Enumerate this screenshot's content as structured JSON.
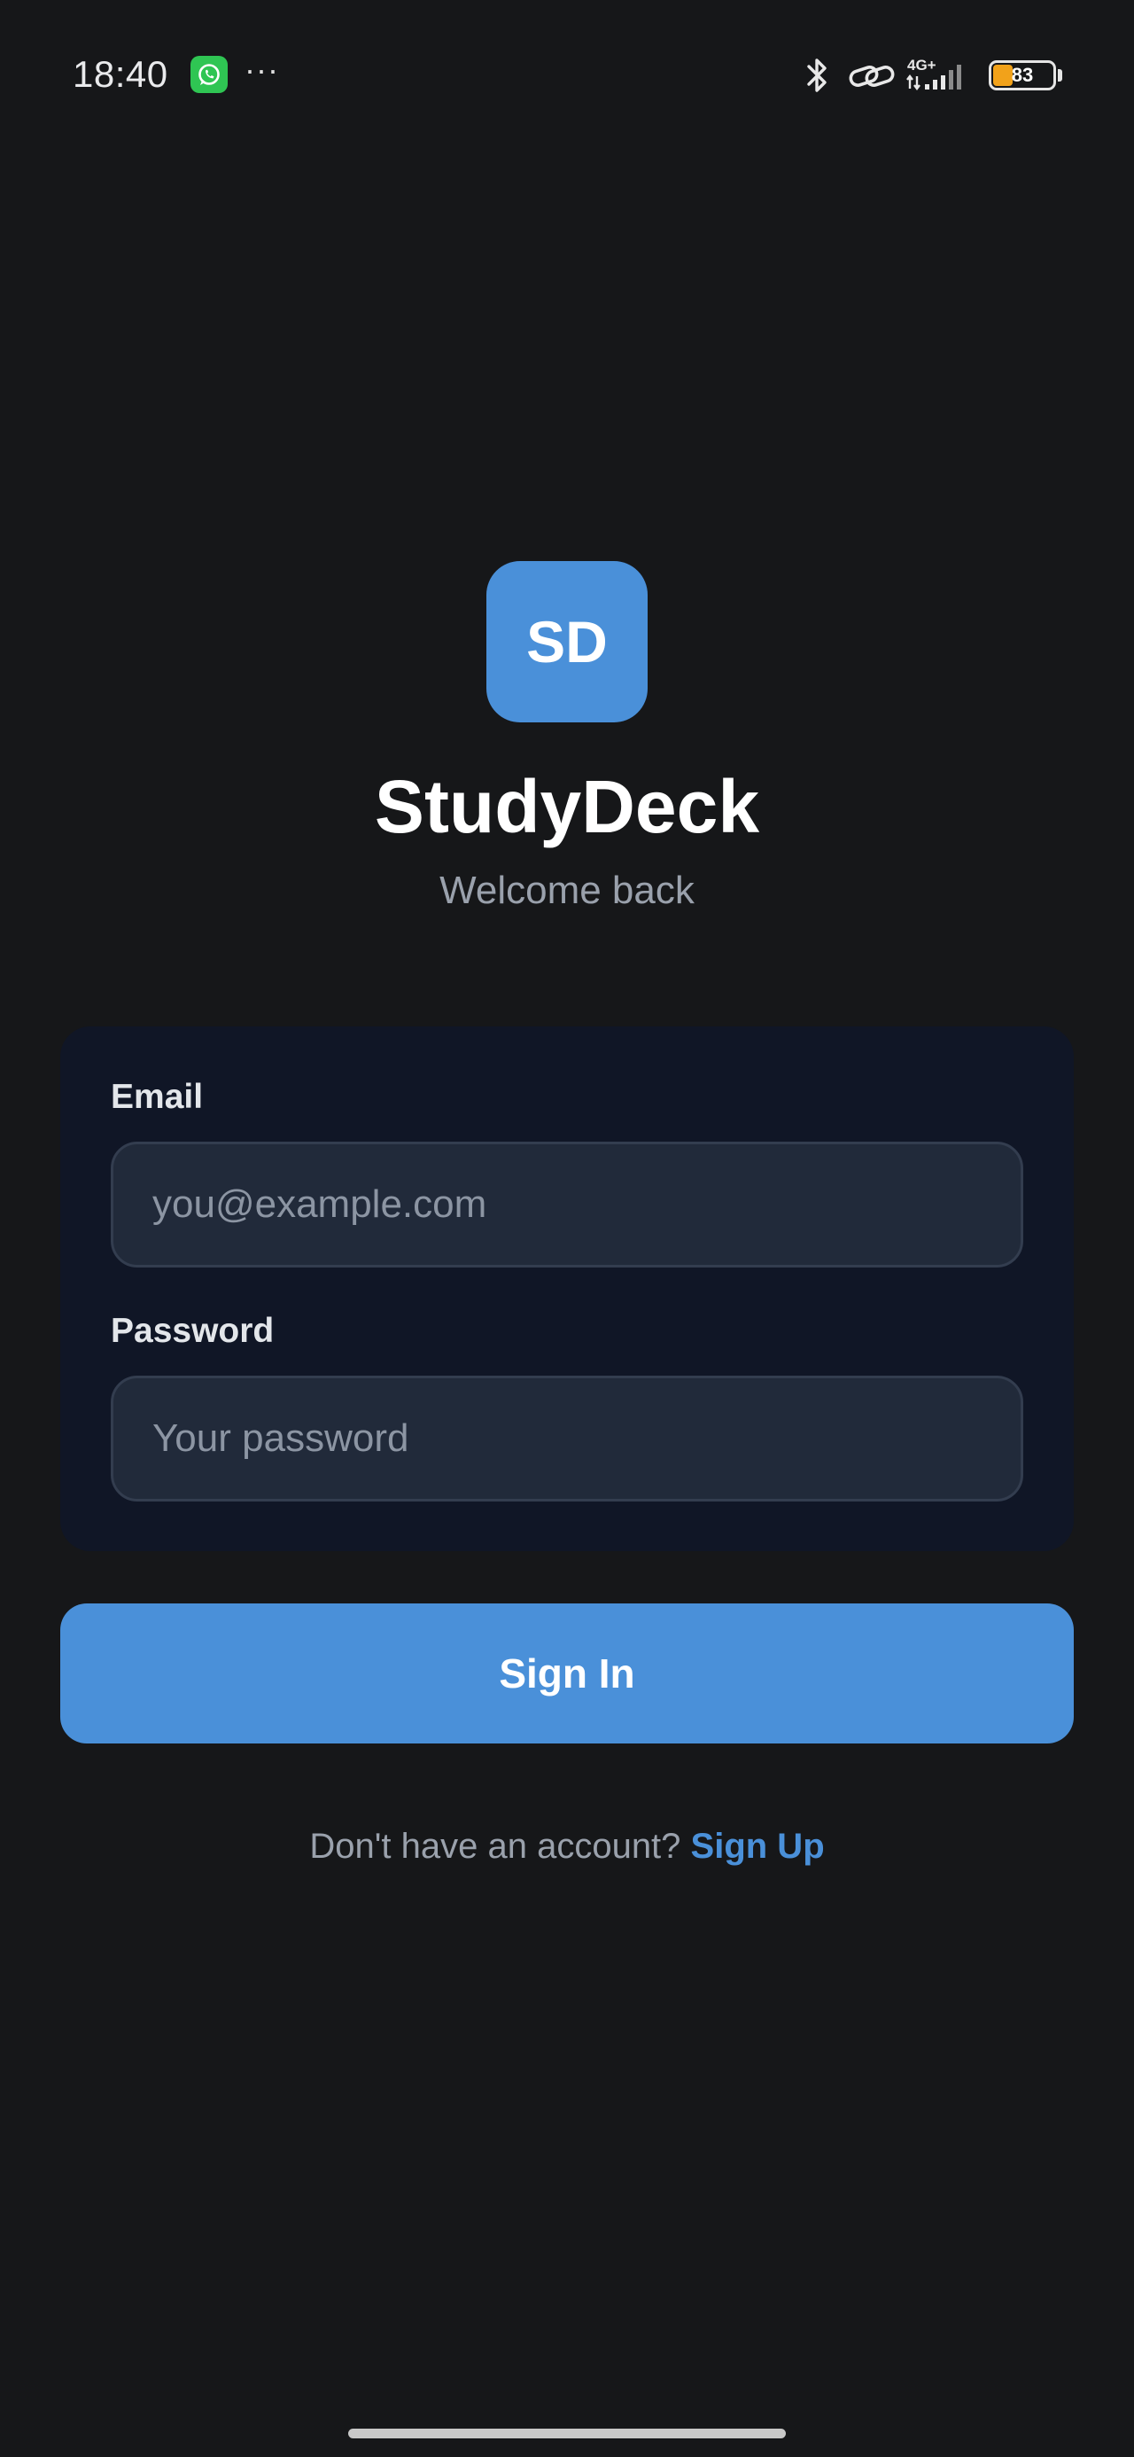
{
  "status_bar": {
    "time": "18:40",
    "more_indicator": "···",
    "network_label": "4G+",
    "battery_level": "83",
    "battery_fraction": 0.33
  },
  "logo": {
    "initials": "SD",
    "color": "#4a90d9"
  },
  "header": {
    "title": "StudyDeck",
    "subtitle": "Welcome back"
  },
  "form": {
    "email_label": "Email",
    "email_placeholder": "you@example.com",
    "email_value": "",
    "password_label": "Password",
    "password_placeholder": "Your password",
    "password_value": ""
  },
  "actions": {
    "sign_in_label": "Sign In",
    "signup_prompt": "Don't have an account? ",
    "signup_link": "Sign Up"
  },
  "colors": {
    "background": "#161719",
    "card": "#101626",
    "input": "#212a3a",
    "accent": "#4a90d9",
    "battery": "#f2a21a"
  }
}
